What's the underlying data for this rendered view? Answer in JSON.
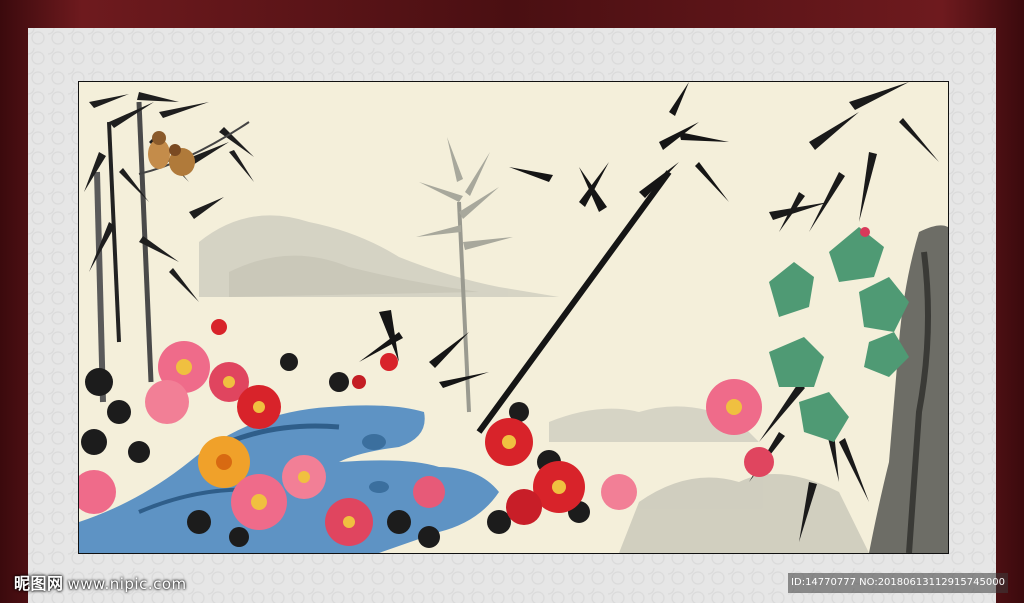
{
  "watermark": {
    "logo_text": "昵图网",
    "site": "www.nipic.com",
    "image_id_line": "ID:14770777 NO:20180613112915745000"
  },
  "colors": {
    "frame": "#4a0d10",
    "mat": "#e6e6e6",
    "paper": "#f4efda",
    "ink": "#1a1a1a",
    "peony_red": "#d8232a",
    "peony_pink": "#ef6b8a",
    "peony_yellow": "#f0a12a",
    "rock_blue": "#5e93c4",
    "leaf_green": "#4f9a74"
  },
  "icons": [
    "bamboo",
    "sparrow",
    "peony",
    "blue-rock",
    "mountains",
    "green-leaves",
    "grey-cliff"
  ]
}
